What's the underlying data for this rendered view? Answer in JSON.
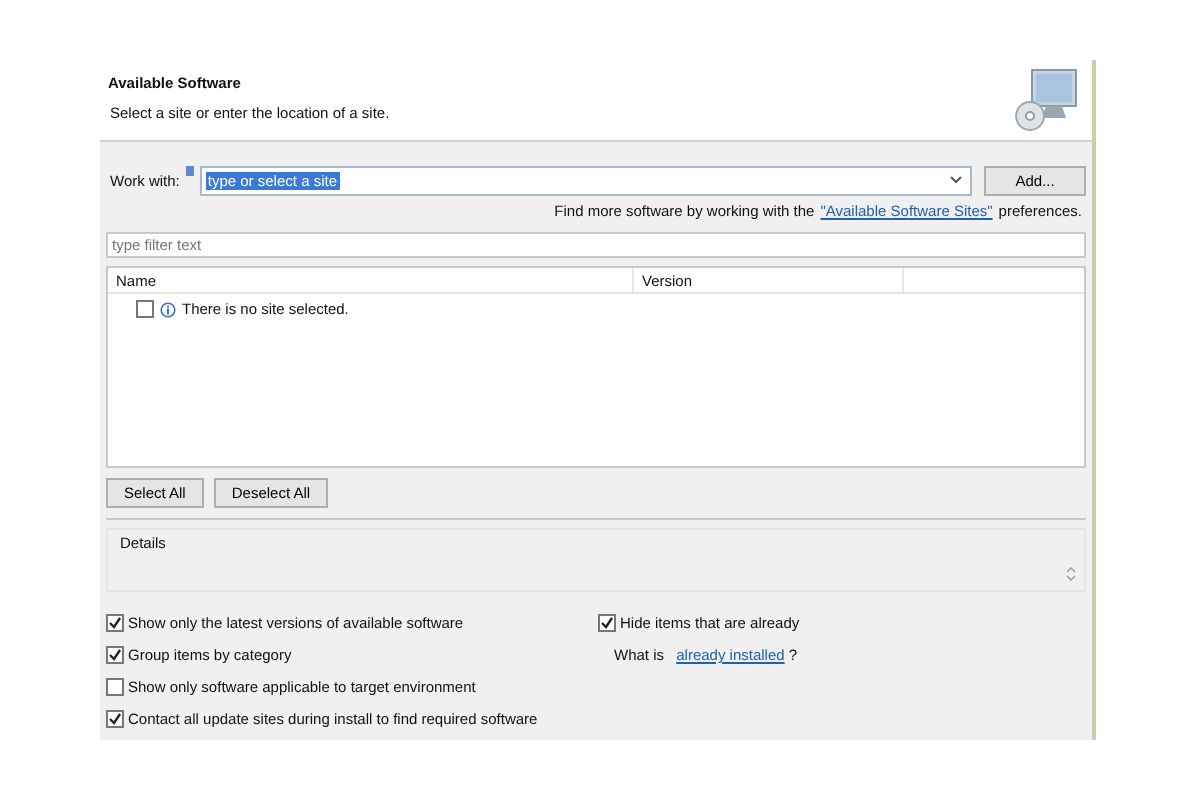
{
  "header": {
    "title": "Available Software",
    "subtitle": "Select a site or enter the location of a site."
  },
  "work_with": {
    "label": "Work with:",
    "value": "type or select a site",
    "add_button": "Add..."
  },
  "find_more": {
    "before": "Find more software by working with the",
    "link": "\"Available Software Sites\"",
    "after": "preferences."
  },
  "filter": {
    "placeholder": "type filter text"
  },
  "table": {
    "columns": [
      "Name",
      "Version"
    ],
    "rows": [
      {
        "checked": false,
        "text": "There is no site selected."
      }
    ]
  },
  "buttons": [
    "Select All",
    "Deselect All"
  ],
  "details": {
    "label": "Details"
  },
  "options_left": [
    {
      "label": "Show only the latest versions of available software",
      "checked": true
    },
    {
      "label": "Group items by category",
      "checked": true
    },
    {
      "label": "Show only software applicable to target environment",
      "checked": false
    },
    {
      "label": "Contact all update sites during install to find required software",
      "checked": true
    }
  ],
  "options_right": {
    "hide": {
      "label": "Hide items that are already",
      "checked": true
    },
    "what_is": {
      "before": "What is",
      "link": "already installed",
      "after": "?"
    }
  }
}
